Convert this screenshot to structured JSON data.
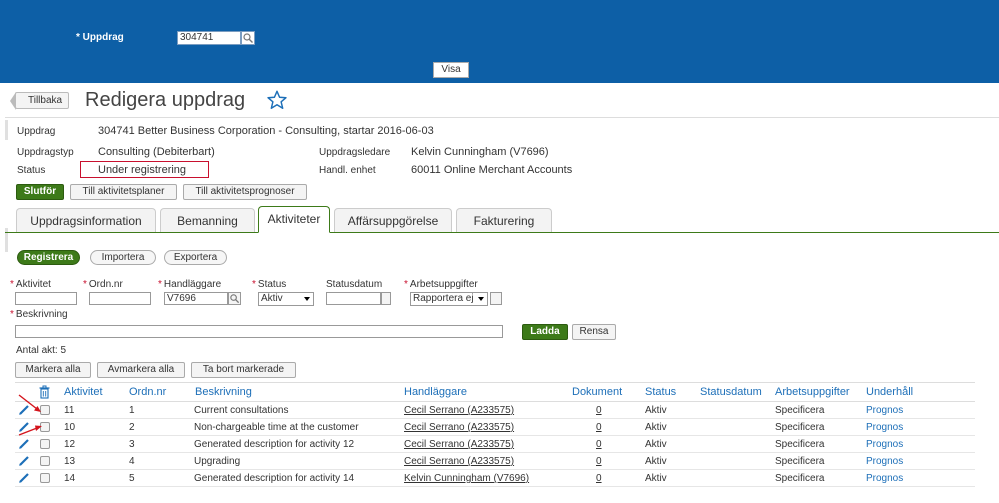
{
  "top": {
    "uppdrag_label": "Uppdrag",
    "uppdrag_value": "304741",
    "visa_label": "Visa"
  },
  "header": {
    "back_label": "Tillbaka",
    "title": "Redigera uppdrag"
  },
  "info": {
    "uppdrag_label": "Uppdrag",
    "uppdrag_value": "304741 Better Business Corporation - Consulting, startar 2016-06-03",
    "typ_label": "Uppdragstyp",
    "typ_value": "Consulting (Debiterbart)",
    "status_label": "Status",
    "status_value": "Under registrering",
    "ledare_label": "Uppdragsledare",
    "ledare_value": "Kelvin Cunningham (V7696)",
    "enhet_label": "Handl. enhet",
    "enhet_value": "60011 Online Merchant Accounts"
  },
  "actions": {
    "slutfor": "Slutför",
    "planer": "Till aktivitetsplaner",
    "prognoser": "Till aktivitetsprognoser"
  },
  "tabs": [
    {
      "label": "Uppdragsinformation"
    },
    {
      "label": "Bemanning"
    },
    {
      "label": "Aktiviteter"
    },
    {
      "label": "Affärsuppgörelse"
    },
    {
      "label": "Fakturering"
    }
  ],
  "subactions": {
    "registrera": "Registrera",
    "importera": "Importera",
    "exportera": "Exportera"
  },
  "filters": {
    "aktivitet_label": "Aktivitet",
    "ordn_label": "Ordn.nr",
    "handlaggare_label": "Handläggare",
    "handlaggare_value": "V7696",
    "status_label": "Status",
    "status_value": "Aktiv",
    "statusdatum_label": "Statusdatum",
    "arbets_label": "Arbetsuppgifter",
    "arbets_value": "Rapportera ej",
    "beskrivning_label": "Beskrivning",
    "ladda": "Ladda",
    "rensa": "Rensa"
  },
  "count_label": "Antal akt: 5",
  "bulk": {
    "markera": "Markera alla",
    "avmarkera": "Avmarkera alla",
    "tabort": "Ta bort markerade"
  },
  "table": {
    "headers": {
      "aktivitet": "Aktivitet",
      "ordn": "Ordn.nr",
      "beskrivning": "Beskrivning",
      "handlaggare": "Handläggare",
      "dokument": "Dokument",
      "status": "Status",
      "statusdatum": "Statusdatum",
      "arbets": "Arbetsuppgifter",
      "underhall": "Underhåll"
    },
    "rows": [
      {
        "aktivitet": "11",
        "ordn": "1",
        "beskrivning": "Current consultations",
        "handlaggare": "Cecil Serrano (A233575)",
        "dokument": "0",
        "status": "Aktiv",
        "statusdatum": "",
        "arbets": "Specificera",
        "underhall": "Prognos"
      },
      {
        "aktivitet": "10",
        "ordn": "2",
        "beskrivning": "Non-chargeable time at the customer",
        "handlaggare": "Cecil Serrano (A233575)",
        "dokument": "0",
        "status": "Aktiv",
        "statusdatum": "",
        "arbets": "Specificera",
        "underhall": "Prognos"
      },
      {
        "aktivitet": "12",
        "ordn": "3",
        "beskrivning": "Generated description for activity 12",
        "handlaggare": "Cecil Serrano (A233575)",
        "dokument": "0",
        "status": "Aktiv",
        "statusdatum": "",
        "arbets": "Specificera",
        "underhall": "Prognos"
      },
      {
        "aktivitet": "13",
        "ordn": "4",
        "beskrivning": "Upgrading",
        "handlaggare": "Cecil Serrano (A233575)",
        "dokument": "0",
        "status": "Aktiv",
        "statusdatum": "",
        "arbets": "Specificera",
        "underhall": "Prognos"
      },
      {
        "aktivitet": "14",
        "ordn": "5",
        "beskrivning": "Generated description for activity 14",
        "handlaggare": "Kelvin Cunningham (V7696)",
        "dokument": "0",
        "status": "Aktiv",
        "statusdatum": "",
        "arbets": "Specificera",
        "underhall": "Prognos"
      }
    ]
  },
  "colors": {
    "topbar": "#0d5fa6",
    "green": "#3d7a19",
    "link": "#1d6fb8",
    "highlight": "#c8102e"
  },
  "icons": {
    "star": "star-icon",
    "search": "search-icon",
    "trash": "trash-icon",
    "edit": "pencil-icon",
    "annotation": "red-arrow-icon"
  }
}
